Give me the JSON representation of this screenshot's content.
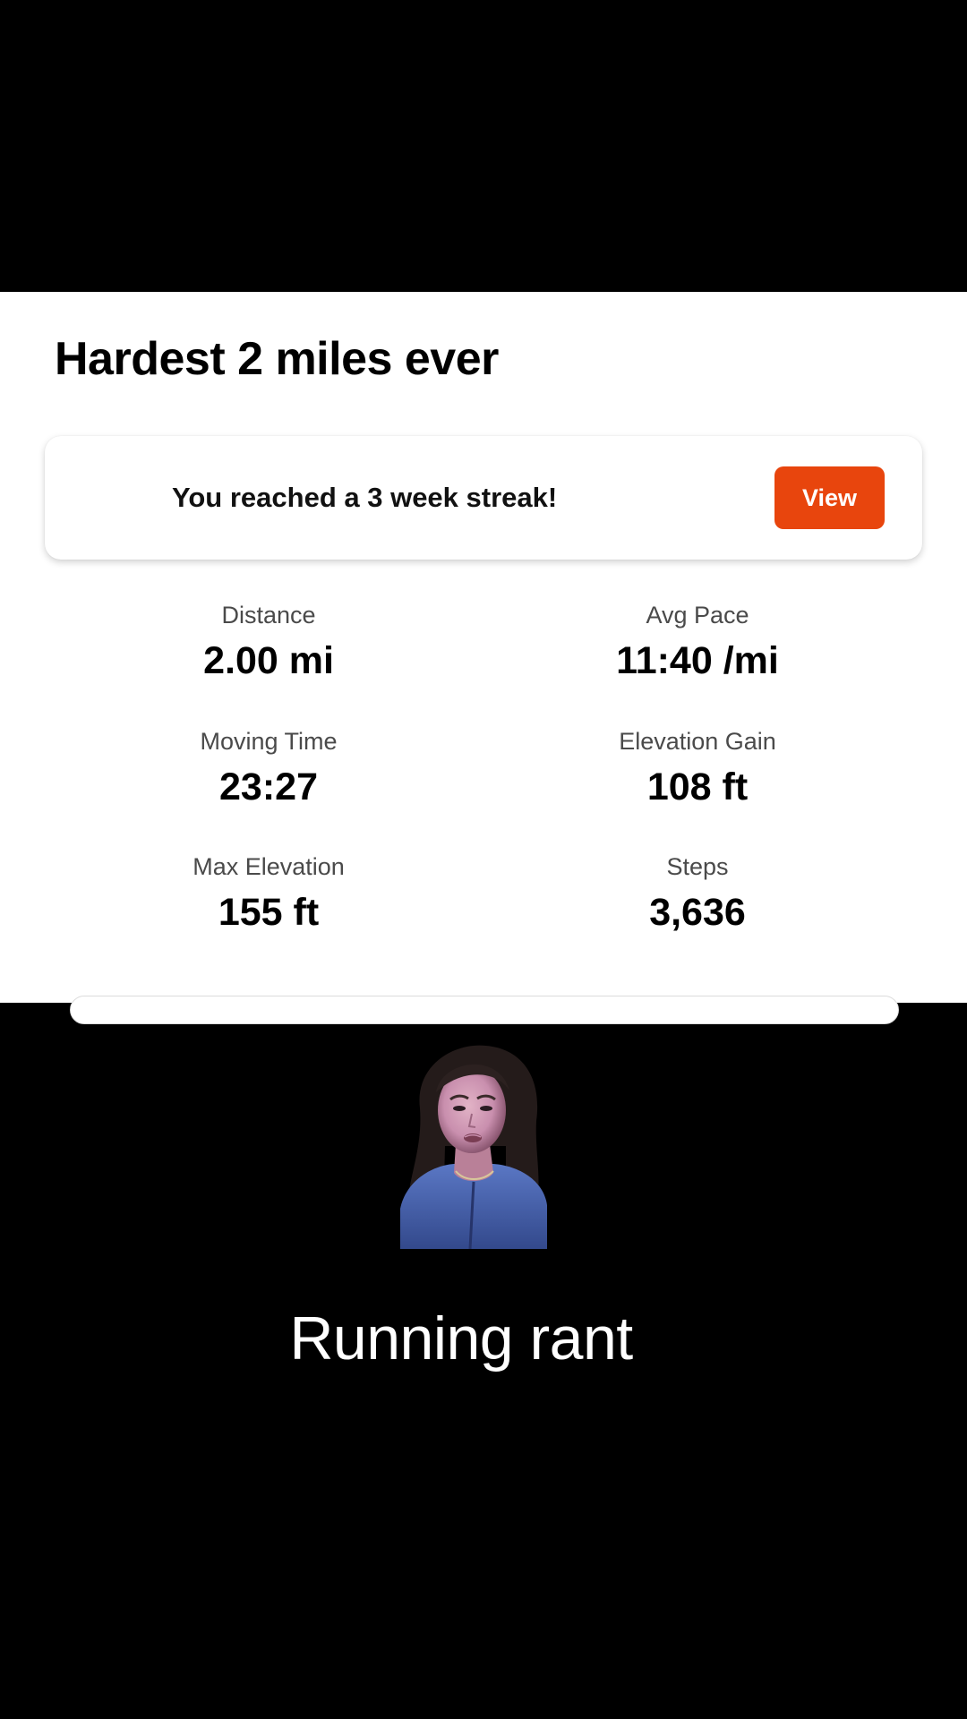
{
  "activity": {
    "title": "Hardest 2 miles ever"
  },
  "streak_card": {
    "message": "You reached a 3 week streak!",
    "button_label": "View",
    "button_color": "#e8450d"
  },
  "stats": [
    {
      "label": "Distance",
      "value": "2.00 mi"
    },
    {
      "label": "Avg Pace",
      "value": "11:40 /mi"
    },
    {
      "label": "Moving Time",
      "value": "23:27"
    },
    {
      "label": "Elevation Gain",
      "value": "108 ft"
    },
    {
      "label": "Max Elevation",
      "value": "155 ft"
    },
    {
      "label": "Steps",
      "value": "3,636"
    }
  ],
  "overlay": {
    "caption": "Running rant"
  },
  "colors": {
    "background": "#000000",
    "panel": "#ffffff",
    "accent": "#e8450d"
  }
}
